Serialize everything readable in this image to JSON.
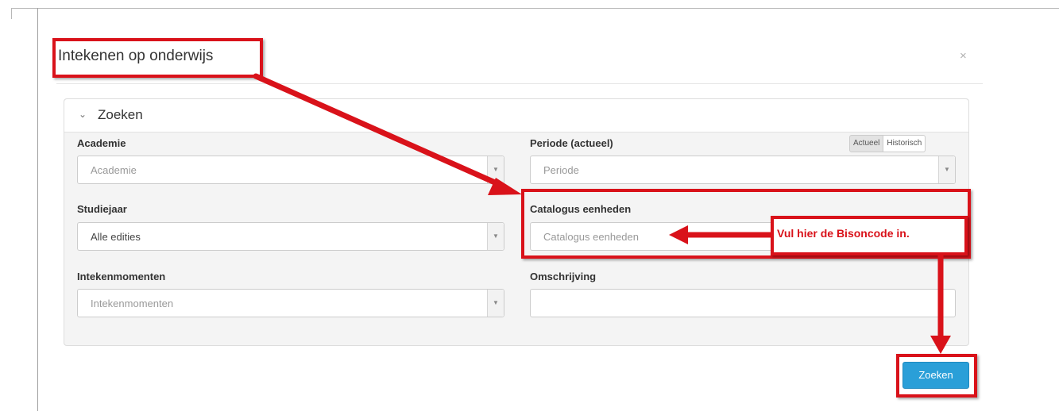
{
  "modal": {
    "title": "Intekenen op onderwijs",
    "close": "×"
  },
  "panel": {
    "title": "Zoeken",
    "chevron": "⌄"
  },
  "fields": {
    "academie": {
      "label": "Academie",
      "placeholder": "Academie"
    },
    "periode": {
      "label": "Periode (actueel)",
      "placeholder": "Periode"
    },
    "periode_toggle": {
      "active": "Actueel",
      "inactive": "Historisch"
    },
    "studiejaar": {
      "label": "Studiejaar",
      "value": "Alle edities"
    },
    "catalogus": {
      "label": "Catalogus eenheden",
      "placeholder": "Catalogus eenheden"
    },
    "intekenmomenten": {
      "label": "Intekenmomenten",
      "placeholder": "Intekenmomenten"
    },
    "omschrijving": {
      "label": "Omschrijving",
      "value": ""
    }
  },
  "callout": {
    "text": "Vul hier de Bisoncode in."
  },
  "actions": {
    "search_label": "Zoeken"
  },
  "colors": {
    "annotation": "#d9121a",
    "primary_button": "#2a9fd8"
  }
}
